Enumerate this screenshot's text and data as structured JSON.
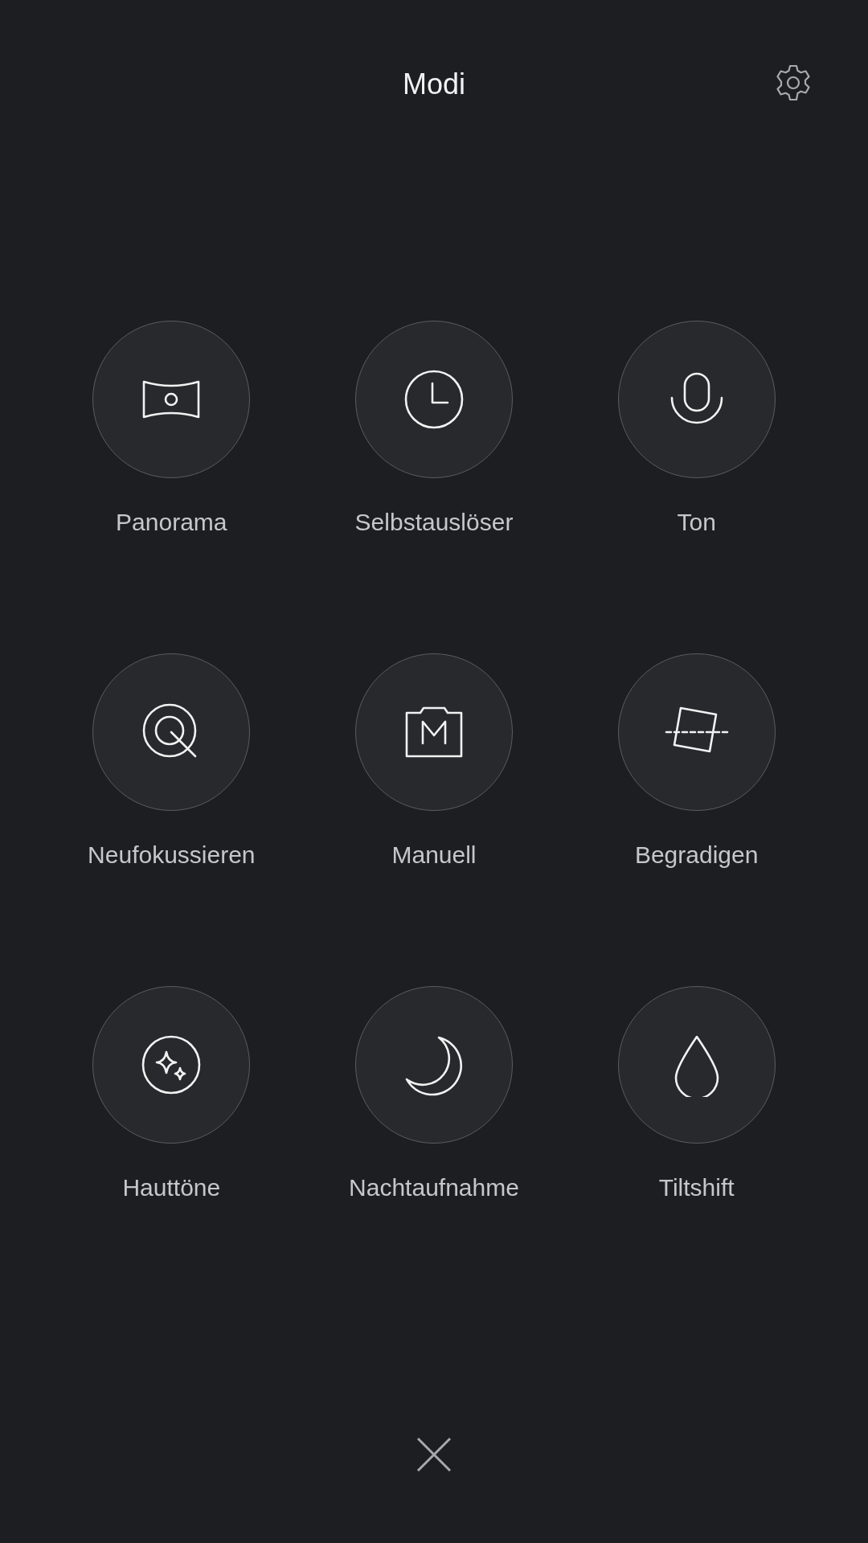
{
  "header": {
    "title": "Modi"
  },
  "modes": [
    {
      "label": "Panorama",
      "kind": "panorama"
    },
    {
      "label": "Selbstauslöser",
      "kind": "timer"
    },
    {
      "label": "Ton",
      "kind": "audio"
    },
    {
      "label": "Neufokussieren",
      "kind": "refocus"
    },
    {
      "label": "Manuell",
      "kind": "manual"
    },
    {
      "label": "Begradigen",
      "kind": "straighten"
    },
    {
      "label": "Hauttöne",
      "kind": "beauty"
    },
    {
      "label": "Nachtaufnahme",
      "kind": "night"
    },
    {
      "label": "Tiltshift",
      "kind": "tiltshift"
    }
  ]
}
